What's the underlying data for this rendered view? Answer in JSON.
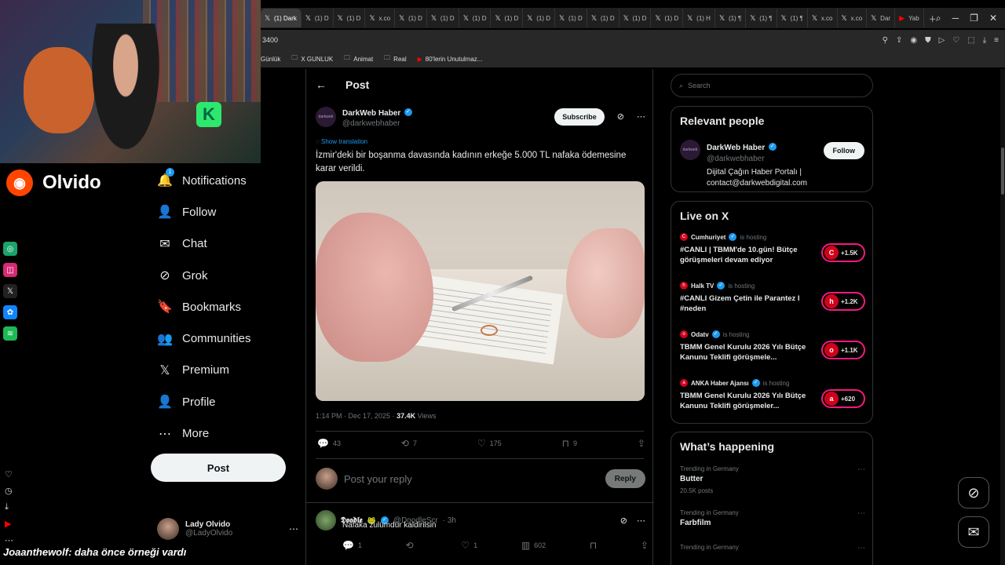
{
  "browser": {
    "tabs": [
      {
        "label": "(1) Dark",
        "icon": "x",
        "active": true
      },
      {
        "label": "(1) D",
        "icon": "x"
      },
      {
        "label": "(1) D",
        "icon": "x"
      },
      {
        "label": "x.co",
        "icon": "x"
      },
      {
        "label": "(1) D",
        "icon": "x"
      },
      {
        "label": "(1) D",
        "icon": "x"
      },
      {
        "label": "(1) D",
        "icon": "x"
      },
      {
        "label": "(1) D",
        "icon": "x"
      },
      {
        "label": "(1) D",
        "icon": "x"
      },
      {
        "label": "(1) D",
        "icon": "x"
      },
      {
        "label": "(1) D",
        "icon": "x"
      },
      {
        "label": "(1) D",
        "icon": "x"
      },
      {
        "label": "(1) D",
        "icon": "x"
      },
      {
        "label": "(1) H",
        "icon": "x"
      },
      {
        "label": "(1) ¶",
        "icon": "x"
      },
      {
        "label": "(1) ¶",
        "icon": "x"
      },
      {
        "label": "(1) ¶",
        "icon": "x"
      },
      {
        "label": "x.co",
        "icon": "x"
      },
      {
        "label": "x.co",
        "icon": "x"
      },
      {
        "label": "Dar",
        "icon": "x"
      },
      {
        "label": "Yab",
        "icon": "youtube"
      }
    ],
    "url": "3400",
    "bookmarks": [
      {
        "label": "Günlük",
        "icon": "none"
      },
      {
        "label": "X GUNLUK",
        "icon": "folder"
      },
      {
        "label": "Animat",
        "icon": "folder"
      },
      {
        "label": "Real",
        "icon": "folder"
      },
      {
        "label": "80'lerin Unutulmaz...",
        "icon": "youtube"
      }
    ]
  },
  "stream": {
    "channel_name": "Olvido",
    "chat_message": "Joaanthewolf: daha önce örneği vardı"
  },
  "nav": {
    "items": [
      {
        "label": "Notifications",
        "icon": "bell-icon",
        "glyph": "🔔",
        "badge": "1"
      },
      {
        "label": "Follow",
        "icon": "person-plus-icon",
        "glyph": "👤"
      },
      {
        "label": "Chat",
        "icon": "envelope-icon",
        "glyph": "✉"
      },
      {
        "label": "Grok",
        "icon": "grok-icon",
        "glyph": "⊘"
      },
      {
        "label": "Bookmarks",
        "icon": "bookmark-icon",
        "glyph": "🔖"
      },
      {
        "label": "Communities",
        "icon": "people-icon",
        "glyph": "👥"
      },
      {
        "label": "Premium",
        "icon": "x-logo-icon",
        "glyph": "𝕏"
      },
      {
        "label": "Profile",
        "icon": "person-icon",
        "glyph": "👤"
      },
      {
        "label": "More",
        "icon": "more-circle-icon",
        "glyph": "⋯"
      }
    ],
    "post_label": "Post",
    "account": {
      "name": "Lady Olvido",
      "handle": "@LadyOlvido"
    }
  },
  "post": {
    "header_title": "Post",
    "author": {
      "name": "DarkWeb Haber",
      "handle": "@darkwebhaber",
      "avatar_text": "darkweb"
    },
    "subscribe_label": "Subscribe",
    "show_translation": "Show translation",
    "text": "İzmir'deki bir boşanma davasında kadının erkeğe 5.000 TL nafaka ödemesine karar verildi.",
    "timestamp": "1:14 PM · Dec 17, 2025 · ",
    "views_count": "37.4K",
    "views_label": " Views",
    "stats": {
      "replies": "43",
      "reposts": "7",
      "likes": "175",
      "bookmarks": "9"
    },
    "reply_placeholder": "Post your reply",
    "reply_button": "Reply"
  },
  "reply": {
    "name": "𝕯𝖔𝖔𝖉𝖑𝖊",
    "handle": "@DoodleScr",
    "time": "· 3h",
    "text": "Nafaka zulümdür kaldirilsin",
    "stats": {
      "replies": "1",
      "reposts": "",
      "likes": "1",
      "views": "602"
    }
  },
  "sidebar": {
    "search_placeholder": "Search",
    "relevant_title": "Relevant people",
    "relevant": {
      "name": "DarkWeb Haber",
      "handle": "@darkwebhaber",
      "bio": "Dijital Çağın Haber Portalı | contact@darkwebdigital.com",
      "follow_label": "Follow"
    },
    "live_title": "Live on X",
    "live": [
      {
        "host": "Cumhuriyet",
        "status": "is hosting",
        "title": "#CANLI | TBMM'de 10.gün! Bütçe görüşmeleri devam ediyor",
        "count": "+1.5K",
        "av": "C"
      },
      {
        "host": "Halk TV",
        "status": "is hosting",
        "title": "#CANLI Gizem Çetin ile Parantez I #neden",
        "count": "+1.2K",
        "av": "h"
      },
      {
        "host": "Odatv",
        "status": "is hosting",
        "title": "TBMM Genel Kurulu 2026 Yılı Bütçe Kanunu Teklifi görüşmele...",
        "count": "+1.1K",
        "av": "o"
      },
      {
        "host": "ANKA Haber Ajansı",
        "status": "is hosting",
        "title": "TBMM Genel Kurulu 2026 Yılı Bütçe Kanunu Teklifi görüşmeler...",
        "count": "+620",
        "av": "a"
      }
    ],
    "happening_title": "What’s happening",
    "trends": [
      {
        "context": "Trending in Germany",
        "name": "Butter",
        "posts": "20.5K posts"
      },
      {
        "context": "Trending in Germany",
        "name": "Farbfilm",
        "posts": ""
      },
      {
        "context": "Trending in Germany",
        "name": "",
        "posts": ""
      }
    ]
  },
  "colors": {
    "accent": "#1d9bf0",
    "live": "#f91880",
    "brand": "#ff4500"
  }
}
